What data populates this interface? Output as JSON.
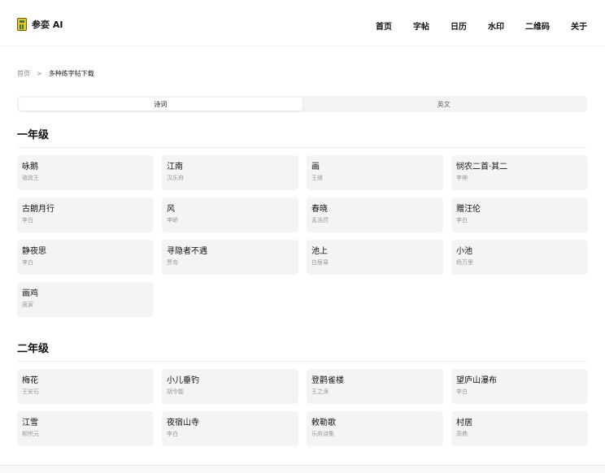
{
  "header": {
    "logo_text": "参娈 AI",
    "nav": [
      "首页",
      "字帖",
      "日历",
      "水印",
      "二维码",
      "关于"
    ]
  },
  "breadcrumb": {
    "home": "首页",
    "separator": ">",
    "current": "多种练字帖下载"
  },
  "tabs": [
    "诗词",
    "英文"
  ],
  "sections": [
    {
      "title": "一年级",
      "poems": [
        {
          "title": "咏鹅",
          "author": "骆宾王"
        },
        {
          "title": "江南",
          "author": "汉乐府"
        },
        {
          "title": "画",
          "author": "王维"
        },
        {
          "title": "悯农二首·其二",
          "author": "李绅"
        },
        {
          "title": "古朗月行",
          "author": "李白"
        },
        {
          "title": "风",
          "author": "李峤"
        },
        {
          "title": "春晓",
          "author": "孟浩然"
        },
        {
          "title": "赠汪伦",
          "author": "李白"
        },
        {
          "title": "静夜思",
          "author": "李白"
        },
        {
          "title": "寻隐者不遇",
          "author": "贾岛"
        },
        {
          "title": "池上",
          "author": "白居易"
        },
        {
          "title": "小池",
          "author": "杨万里"
        },
        {
          "title": "画鸡",
          "author": "唐寅"
        }
      ]
    },
    {
      "title": "二年级",
      "poems": [
        {
          "title": "梅花",
          "author": "王安石"
        },
        {
          "title": "小儿垂钓",
          "author": "胡令能"
        },
        {
          "title": "登鹳雀楼",
          "author": "王之涣"
        },
        {
          "title": "望庐山瀑布",
          "author": "李白"
        },
        {
          "title": "江雪",
          "author": "柳宗元"
        },
        {
          "title": "夜宿山寺",
          "author": "李白"
        },
        {
          "title": "敕勒歌",
          "author": "乐府诗集"
        },
        {
          "title": "村居",
          "author": "高鼎"
        }
      ]
    }
  ]
}
